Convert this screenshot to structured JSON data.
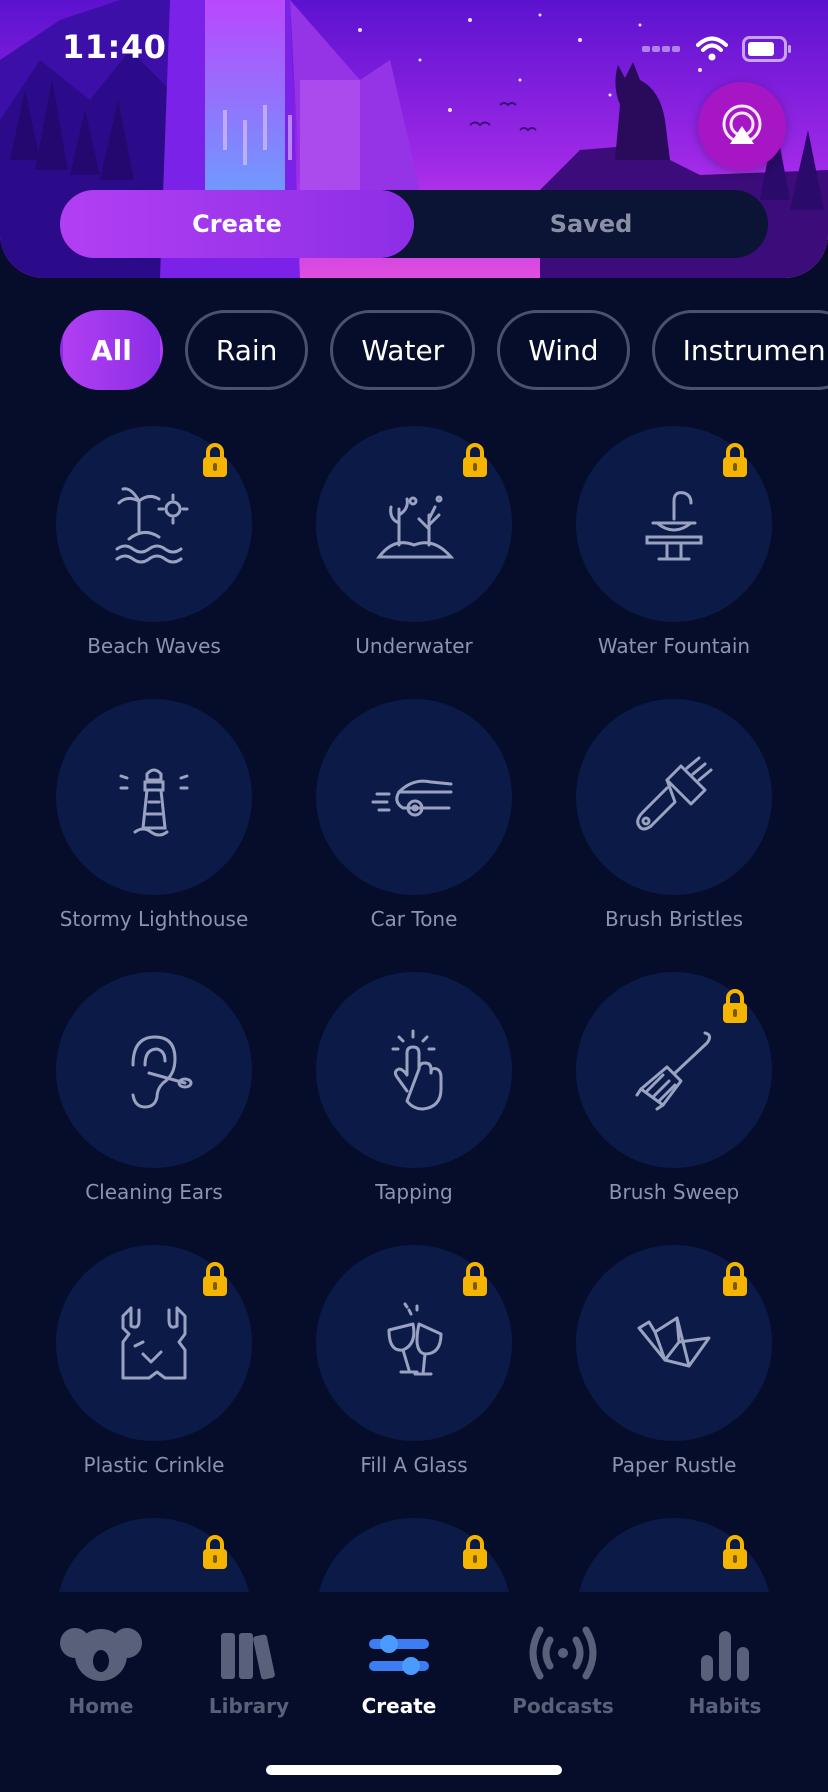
{
  "status_bar": {
    "time": "11:40"
  },
  "segment": {
    "tabs": [
      "Create",
      "Saved"
    ],
    "active": 0
  },
  "filters": [
    "All",
    "Rain",
    "Water",
    "Wind",
    "Instrumen"
  ],
  "sounds": [
    {
      "label": "Beach Waves",
      "icon": "island-icon",
      "locked": true
    },
    {
      "label": "Underwater",
      "icon": "coral-icon",
      "locked": true
    },
    {
      "label": "Water Fountain",
      "icon": "fountain-icon",
      "locked": true
    },
    {
      "label": "Stormy Lighthouse",
      "icon": "lighthouse-icon",
      "locked": false
    },
    {
      "label": "Car Tone",
      "icon": "car-icon",
      "locked": false
    },
    {
      "label": "Brush Bristles",
      "icon": "paint-brush-icon",
      "locked": false
    },
    {
      "label": "Cleaning Ears",
      "icon": "ear-icon",
      "locked": false
    },
    {
      "label": "Tapping",
      "icon": "tap-finger-icon",
      "locked": false
    },
    {
      "label": "Brush Sweep",
      "icon": "broom-icon",
      "locked": true
    },
    {
      "label": "Plastic Crinkle",
      "icon": "plastic-bag-icon",
      "locked": true
    },
    {
      "label": "Fill A Glass",
      "icon": "wine-glasses-icon",
      "locked": true
    },
    {
      "label": "Paper Rustle",
      "icon": "origami-bird-icon",
      "locked": true
    }
  ],
  "tabbar": {
    "items": [
      {
        "label": "Home",
        "icon": "koala-icon"
      },
      {
        "label": "Library",
        "icon": "books-icon"
      },
      {
        "label": "Create",
        "icon": "sliders-icon"
      },
      {
        "label": "Podcasts",
        "icon": "broadcast-icon"
      },
      {
        "label": "Habits",
        "icon": "bar-chart-icon"
      }
    ],
    "active": 2
  },
  "colors": {
    "accent": "#9a35ec",
    "lock": "#f5b400",
    "background": "#050d2a",
    "circle": "#0c1a47"
  }
}
